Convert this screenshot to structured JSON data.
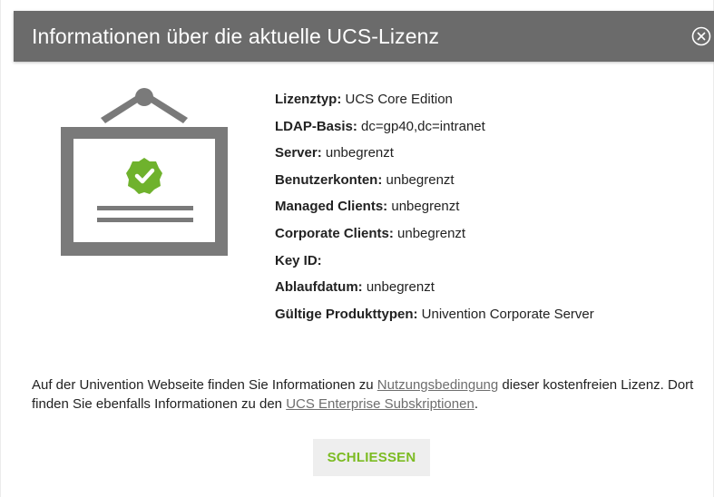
{
  "dialog": {
    "title": "Informationen über die aktuelle UCS-Lizenz",
    "close_icon": "circle-close-icon"
  },
  "license": {
    "icon": "certificate-checkmark-icon",
    "rows": [
      {
        "label": "Lizenztyp:",
        "value": "UCS Core Edition"
      },
      {
        "label": "LDAP-Basis:",
        "value": "dc=gp40,dc=intranet"
      },
      {
        "label": "Server:",
        "value": "unbegrenzt"
      },
      {
        "label": "Benutzerkonten:",
        "value": "unbegrenzt"
      },
      {
        "label": "Managed Clients:",
        "value": "unbegrenzt"
      },
      {
        "label": "Corporate Clients:",
        "value": "unbegrenzt"
      },
      {
        "label": "Key ID:",
        "value": ""
      },
      {
        "label": "Ablaufdatum:",
        "value": "unbegrenzt"
      },
      {
        "label": "Gültige Produkttypen:",
        "value": "Univention Corporate Server"
      }
    ]
  },
  "notice": {
    "part1": "Auf der Univention Webseite finden Sie Informationen zu ",
    "link1": "Nutzungsbedingung",
    "part2": " dieser kostenfreien Lizenz. Dort finden Sie ebenfalls Informationen zu den ",
    "link2": "UCS Enterprise Subskriptionen",
    "part3": "."
  },
  "buttons": {
    "close_label": "SCHLIESSEN"
  },
  "colors": {
    "titlebar": "#6b6b6b",
    "accent": "#7cbb22",
    "icon_gray": "#7a7a7a",
    "badge_green": "#6fb22d"
  }
}
